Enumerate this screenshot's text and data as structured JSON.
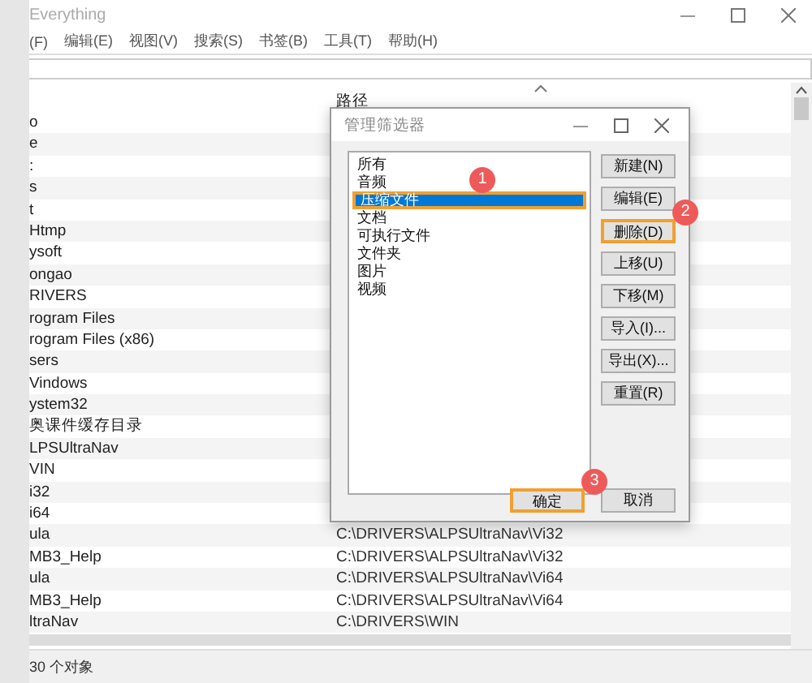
{
  "window": {
    "title": "Everything"
  },
  "menu": [
    "(F)",
    "编辑(E)",
    "视图(V)",
    "搜索(S)",
    "书签(B)",
    "工具(T)",
    "帮助(H)"
  ],
  "table": {
    "path_header": "路径",
    "rows": [
      {
        "name": "o",
        "path": ""
      },
      {
        "name": "e",
        "path": ""
      },
      {
        "name": ":",
        "path": ""
      },
      {
        "name": "s",
        "path": ""
      },
      {
        "name": "t",
        "path": ""
      },
      {
        "name": "Htmp",
        "path": ""
      },
      {
        "name": "ysoft",
        "path": ""
      },
      {
        "name": "ongao",
        "path": ""
      },
      {
        "name": "RIVERS",
        "path": ""
      },
      {
        "name": "rogram Files",
        "path": ""
      },
      {
        "name": "rogram Files (x86)",
        "path": ""
      },
      {
        "name": "sers",
        "path": ""
      },
      {
        "name": "Vindows",
        "path": ""
      },
      {
        "name": "ystem32",
        "path": ""
      },
      {
        "name": "奥课件缓存目录",
        "path": ""
      },
      {
        "name": "LPSUltraNav",
        "path": ""
      },
      {
        "name": "VIN",
        "path": ""
      },
      {
        "name": "i32",
        "path": ""
      },
      {
        "name": "i64",
        "path": ""
      },
      {
        "name": "ula",
        "path": "C:\\DRIVERS\\ALPSUltraNav\\Vi32"
      },
      {
        "name": "MB3_Help",
        "path": "C:\\DRIVERS\\ALPSUltraNav\\Vi32"
      },
      {
        "name": "ula",
        "path": "C:\\DRIVERS\\ALPSUltraNav\\Vi64"
      },
      {
        "name": "MB3_Help",
        "path": "C:\\DRIVERS\\ALPSUltraNav\\Vi64"
      },
      {
        "name": "ltraNav",
        "path": "C:\\DRIVERS\\WIN"
      }
    ]
  },
  "status_bar": "30 个对象",
  "dialog": {
    "title": "管理筛选器",
    "filters": [
      {
        "label": "所有",
        "selected": false
      },
      {
        "label": "音频",
        "selected": false
      },
      {
        "label": "压缩文件",
        "selected": true,
        "callout": "1"
      },
      {
        "label": "文档",
        "selected": false
      },
      {
        "label": "可执行文件",
        "selected": false
      },
      {
        "label": "文件夹",
        "selected": false
      },
      {
        "label": "图片",
        "selected": false
      },
      {
        "label": "视频",
        "selected": false
      }
    ],
    "side_buttons": [
      {
        "label": "新建(N)"
      },
      {
        "label": "编辑(E)"
      },
      {
        "label": "删除(D)",
        "callout": "2"
      },
      {
        "label": "上移(U)"
      },
      {
        "label": "下移(M)"
      },
      {
        "label": "导入(I)..."
      },
      {
        "label": "导出(X)..."
      },
      {
        "label": "重置(R)"
      }
    ],
    "ok": {
      "label": "确定",
      "callout": "3"
    },
    "cancel": {
      "label": "取消"
    }
  }
}
